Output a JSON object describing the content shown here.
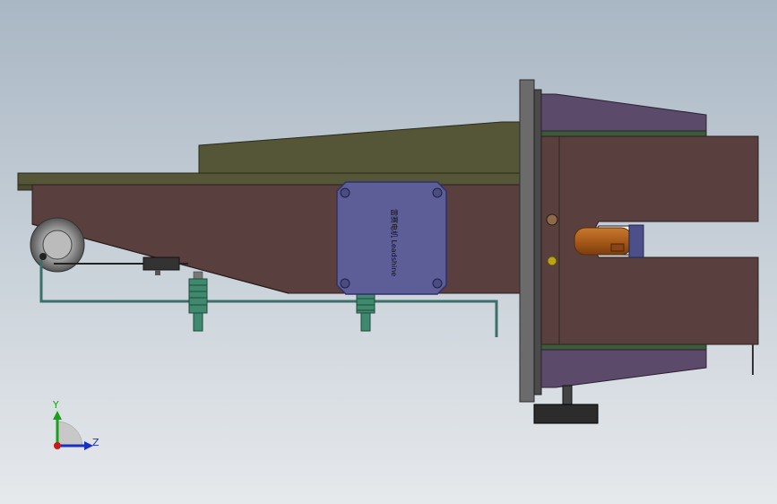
{
  "viewport": {
    "background_top": "#a9b7c4",
    "background_bottom": "#e6e9ec"
  },
  "colors": {
    "brown_body": "#5a3f3f",
    "brown_dark": "#3e2b2b",
    "olive_plate": "#555638",
    "olive_dark": "#3d3e26",
    "purple_face": "#5b4a6a",
    "blue_box": "#5d5e98",
    "blue_box_edge": "#2f3066",
    "green_sensor": "#3f8a6e",
    "steel_plate": "#6b6b6b",
    "orange_cyl": "#a85a1a",
    "dark_gear": "#2c2c2c"
  },
  "box_label": "雷赛电机 Leadshine",
  "triad": {
    "y_label": "Y",
    "z_label": "Z",
    "y_color": "#1aa01a",
    "z_color": "#1a2fc8",
    "origin_color": "#c81a1a"
  }
}
